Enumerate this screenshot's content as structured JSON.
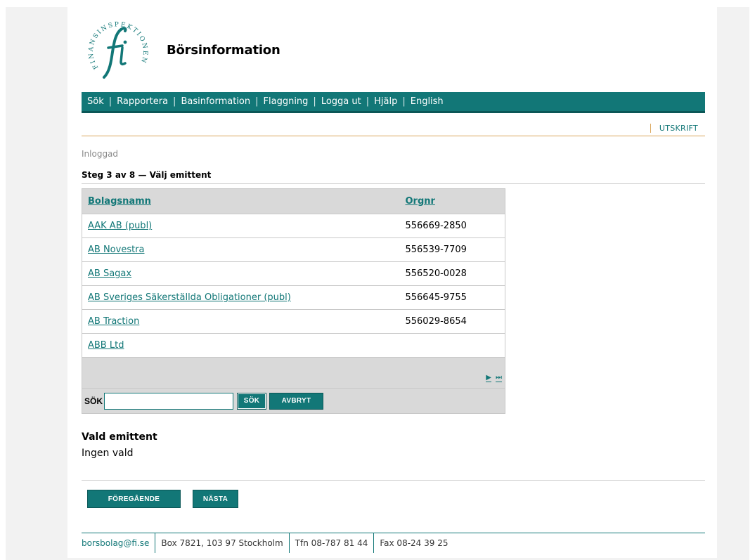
{
  "site": {
    "title": "Börsinformation",
    "logo_text": "FINANSINSPEKTIONEN"
  },
  "nav": {
    "items": [
      {
        "label": "Sök"
      },
      {
        "label": "Rapportera"
      },
      {
        "label": "Basinformation"
      },
      {
        "label": "Flaggning"
      },
      {
        "label": "Logga ut"
      },
      {
        "label": "Hjälp"
      },
      {
        "label": "English"
      }
    ]
  },
  "print_label": "UTSKRIFT",
  "status": "Inloggad",
  "step_title": "Steg 3 av 8 — Välj emittent",
  "table": {
    "col_name": "Bolagsnamn",
    "col_orgnr": "Orgnr",
    "rows": [
      {
        "name": "AAK AB (publ)",
        "orgnr": "556669-2850"
      },
      {
        "name": "AB Novestra",
        "orgnr": "556539-7709"
      },
      {
        "name": "AB Sagax",
        "orgnr": "556520-0028"
      },
      {
        "name": "AB Sveriges Säkerställda Obligationer (publ)",
        "orgnr": "556645-9755"
      },
      {
        "name": "AB Traction",
        "orgnr": "556029-8654"
      },
      {
        "name": "ABB Ltd",
        "orgnr": ""
      }
    ],
    "pager_next": "▶",
    "pager_last": "⏭"
  },
  "search": {
    "label": "SÖK",
    "value": "",
    "button": "SÖK",
    "cancel": "AVBRYT"
  },
  "chosen": {
    "heading": "Vald emittent",
    "value": "Ingen vald"
  },
  "buttons": {
    "prev": "FÖREGÅENDE",
    "next": "NÄSTA"
  },
  "footer": {
    "email": "borsbolag@fi.se",
    "address": "Box 7821, 103 97 Stockholm",
    "phone": "Tfn 08-787 81 44",
    "fax": "Fax 08-24 39 25"
  },
  "colors": {
    "accent": "#127777",
    "divider": "#d9a55a",
    "grid_bg": "#d9d9d9"
  }
}
